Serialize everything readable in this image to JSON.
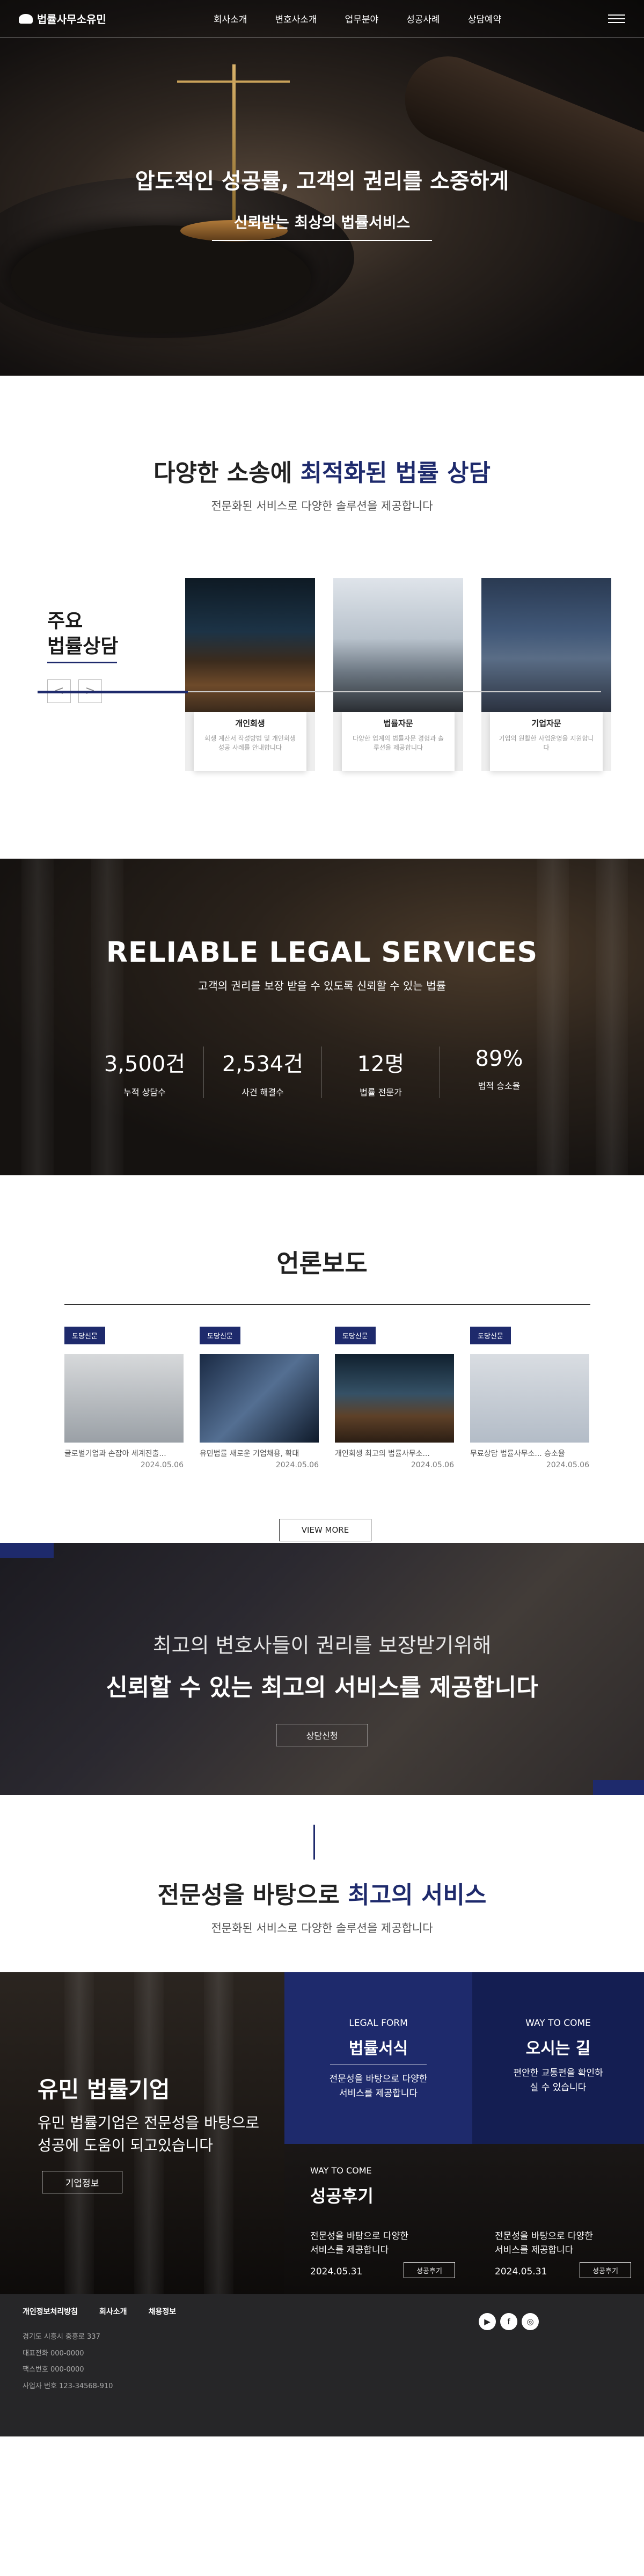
{
  "nav": {
    "logo": "법률사무소유민",
    "menu": [
      "회사소개",
      "변호사소개",
      "업무분야",
      "성공사례",
      "상담예약"
    ]
  },
  "hero": {
    "title": "압도적인 성공률, 고객의 권리를 소중하게",
    "subtitle": "신뢰받는 최상의 법률서비스"
  },
  "consult": {
    "title_a": "다양한 소송에 ",
    "title_b": "최적화된 법률 상담",
    "sub": "전문화된 서비스로 다양한 솔루션을 제공합니다",
    "side_title_1": "주요",
    "side_title_2": "법률상담",
    "prev": "<",
    "next": ">",
    "cards": [
      {
        "title": "개인회생",
        "desc": "회생 계산서 작성방법 및 개인회생 성공 사례를 안내합니다"
      },
      {
        "title": "법률자문",
        "desc": "다양한 업계의 법률자문 경험과 솔루션을 제공합니다"
      },
      {
        "title": "기업자문",
        "desc": "기업의 원활한 사업운영을 지원합니다"
      }
    ]
  },
  "reliable": {
    "title": "RELIABLE LEGAL SERVICES",
    "sub": "고객의 권리를 보장 받을 수 있도록 신뢰할 수 있는 법률",
    "stats": [
      {
        "num": "3,500건",
        "label": "누적 상담수"
      },
      {
        "num": "2,534건",
        "label": "사건 해결수"
      },
      {
        "num": "12명",
        "label": "법률 전문가"
      },
      {
        "num": "89%",
        "label": "법적 승소율"
      }
    ]
  },
  "press": {
    "title": "언론보도",
    "more": "VIEW MORE",
    "items": [
      {
        "tag": "도당신문",
        "text": "글로벌기업과 손잡아 세계진출...",
        "date": "2024.05.06"
      },
      {
        "tag": "도당신문",
        "text": "유민법률 새로운 기업채용, 확대",
        "date": "2024.05.06"
      },
      {
        "tag": "도당신문",
        "text": "개인회생 최고의 법률사무소...",
        "date": "2024.05.06"
      },
      {
        "tag": "도당신문",
        "text": "무료상담 법률사무소... 승소율",
        "date": "2024.05.06"
      }
    ]
  },
  "banner": {
    "line1": "최고의 변호사들이 권리를 보장받기위해",
    "line2": "신뢰할 수 있는 최고의 서비스를 제공합니다",
    "btn": "상담신청"
  },
  "service": {
    "title_a": "전문성을 바탕으로 ",
    "title_b": "최고의 서비스",
    "sub": "전문화된 서비스로 다양한 솔루션을 제공합니다"
  },
  "grid": {
    "corp_title": "유민 법률기업",
    "corp_desc_1": "유민 법률기업은 전문성을 바탕으로",
    "corp_desc_2": "성공에 도움이 되고있습니다",
    "corp_btn": "기업정보",
    "form_small": "LEGAL FORM",
    "form_large": "법률서식",
    "form_desc_1": "전문성을 바탕으로 다양한",
    "form_desc_2": "서비스를 제공합니다",
    "way_small": "WAY TO COME",
    "way_large": "오시는 길",
    "way_desc_1": "편안한 교통편을 확인하",
    "way_desc_2": "실 수 있습니다",
    "review_small": "WAY TO COME",
    "review_large": "성공후기",
    "review1_1": "전문성을 바탕으로 다양한",
    "review1_2": "서비스를 제공합니다",
    "review1_date": "2024.05.31",
    "review1_btn": "성공후기",
    "review2_1": "전문성을 바탕으로 다양한",
    "review2_2": "서비스를 제공합니다",
    "review2_date": "2024.05.31",
    "review2_btn": "성공후기"
  },
  "footer": {
    "links": [
      "개인정보처리방침",
      "회사소개",
      "채용정보"
    ],
    "address": "경기도 시흥시 중흥로 337",
    "tel": "대표전화 000-0000",
    "fax": "팩스번호 000-0000",
    "biz": "사업자 번호 123-34568-910"
  }
}
